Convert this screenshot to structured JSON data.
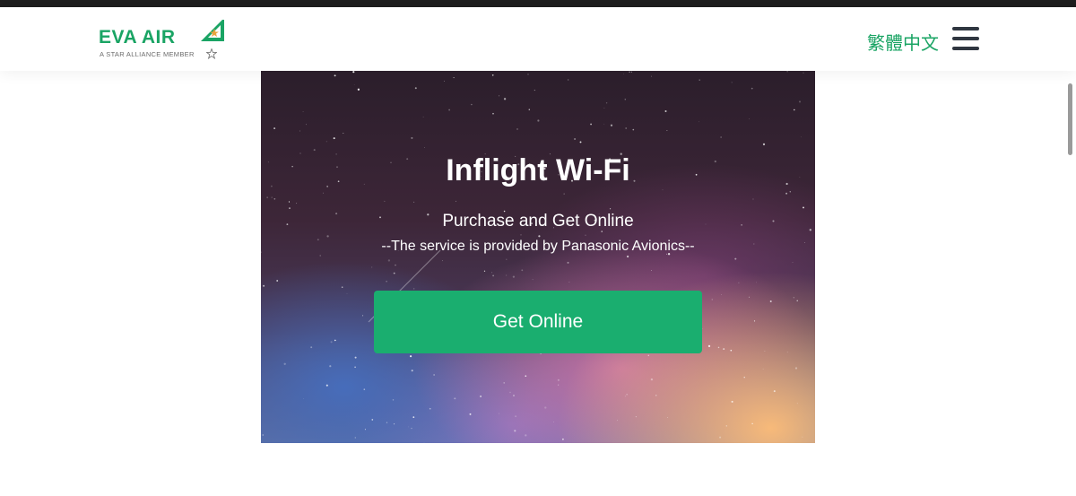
{
  "header": {
    "logo_word": "EVA AIR",
    "logo_tagline": "A STAR ALLIANCE MEMBER",
    "language_link": "繁體中文",
    "menu_icon": "hamburger-menu-icon",
    "brand_color": "#1aa464"
  },
  "hero": {
    "title": "Inflight Wi-Fi",
    "subtitle": "Purchase and Get Online",
    "provider_note": "--The service is provided by Panasonic Avionics--",
    "button_label": "Get Online",
    "button_color": "#1aae6f"
  }
}
